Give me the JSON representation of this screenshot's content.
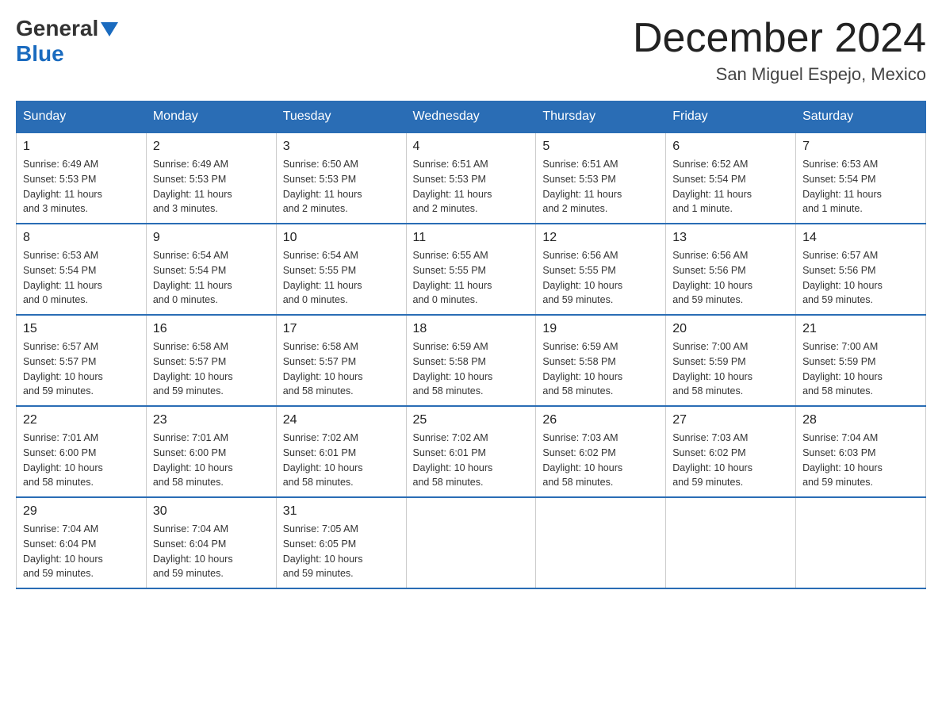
{
  "header": {
    "logo_general": "General",
    "logo_blue": "Blue",
    "title": "December 2024",
    "subtitle": "San Miguel Espejo, Mexico"
  },
  "days_of_week": [
    "Sunday",
    "Monday",
    "Tuesday",
    "Wednesday",
    "Thursday",
    "Friday",
    "Saturday"
  ],
  "weeks": [
    [
      {
        "day": "1",
        "sunrise": "6:49 AM",
        "sunset": "5:53 PM",
        "daylight": "11 hours and 3 minutes."
      },
      {
        "day": "2",
        "sunrise": "6:49 AM",
        "sunset": "5:53 PM",
        "daylight": "11 hours and 3 minutes."
      },
      {
        "day": "3",
        "sunrise": "6:50 AM",
        "sunset": "5:53 PM",
        "daylight": "11 hours and 2 minutes."
      },
      {
        "day": "4",
        "sunrise": "6:51 AM",
        "sunset": "5:53 PM",
        "daylight": "11 hours and 2 minutes."
      },
      {
        "day": "5",
        "sunrise": "6:51 AM",
        "sunset": "5:53 PM",
        "daylight": "11 hours and 2 minutes."
      },
      {
        "day": "6",
        "sunrise": "6:52 AM",
        "sunset": "5:54 PM",
        "daylight": "11 hours and 1 minute."
      },
      {
        "day": "7",
        "sunrise": "6:53 AM",
        "sunset": "5:54 PM",
        "daylight": "11 hours and 1 minute."
      }
    ],
    [
      {
        "day": "8",
        "sunrise": "6:53 AM",
        "sunset": "5:54 PM",
        "daylight": "11 hours and 0 minutes."
      },
      {
        "day": "9",
        "sunrise": "6:54 AM",
        "sunset": "5:54 PM",
        "daylight": "11 hours and 0 minutes."
      },
      {
        "day": "10",
        "sunrise": "6:54 AM",
        "sunset": "5:55 PM",
        "daylight": "11 hours and 0 minutes."
      },
      {
        "day": "11",
        "sunrise": "6:55 AM",
        "sunset": "5:55 PM",
        "daylight": "11 hours and 0 minutes."
      },
      {
        "day": "12",
        "sunrise": "6:56 AM",
        "sunset": "5:55 PM",
        "daylight": "10 hours and 59 minutes."
      },
      {
        "day": "13",
        "sunrise": "6:56 AM",
        "sunset": "5:56 PM",
        "daylight": "10 hours and 59 minutes."
      },
      {
        "day": "14",
        "sunrise": "6:57 AM",
        "sunset": "5:56 PM",
        "daylight": "10 hours and 59 minutes."
      }
    ],
    [
      {
        "day": "15",
        "sunrise": "6:57 AM",
        "sunset": "5:57 PM",
        "daylight": "10 hours and 59 minutes."
      },
      {
        "day": "16",
        "sunrise": "6:58 AM",
        "sunset": "5:57 PM",
        "daylight": "10 hours and 59 minutes."
      },
      {
        "day": "17",
        "sunrise": "6:58 AM",
        "sunset": "5:57 PM",
        "daylight": "10 hours and 58 minutes."
      },
      {
        "day": "18",
        "sunrise": "6:59 AM",
        "sunset": "5:58 PM",
        "daylight": "10 hours and 58 minutes."
      },
      {
        "day": "19",
        "sunrise": "6:59 AM",
        "sunset": "5:58 PM",
        "daylight": "10 hours and 58 minutes."
      },
      {
        "day": "20",
        "sunrise": "7:00 AM",
        "sunset": "5:59 PM",
        "daylight": "10 hours and 58 minutes."
      },
      {
        "day": "21",
        "sunrise": "7:00 AM",
        "sunset": "5:59 PM",
        "daylight": "10 hours and 58 minutes."
      }
    ],
    [
      {
        "day": "22",
        "sunrise": "7:01 AM",
        "sunset": "6:00 PM",
        "daylight": "10 hours and 58 minutes."
      },
      {
        "day": "23",
        "sunrise": "7:01 AM",
        "sunset": "6:00 PM",
        "daylight": "10 hours and 58 minutes."
      },
      {
        "day": "24",
        "sunrise": "7:02 AM",
        "sunset": "6:01 PM",
        "daylight": "10 hours and 58 minutes."
      },
      {
        "day": "25",
        "sunrise": "7:02 AM",
        "sunset": "6:01 PM",
        "daylight": "10 hours and 58 minutes."
      },
      {
        "day": "26",
        "sunrise": "7:03 AM",
        "sunset": "6:02 PM",
        "daylight": "10 hours and 58 minutes."
      },
      {
        "day": "27",
        "sunrise": "7:03 AM",
        "sunset": "6:02 PM",
        "daylight": "10 hours and 59 minutes."
      },
      {
        "day": "28",
        "sunrise": "7:04 AM",
        "sunset": "6:03 PM",
        "daylight": "10 hours and 59 minutes."
      }
    ],
    [
      {
        "day": "29",
        "sunrise": "7:04 AM",
        "sunset": "6:04 PM",
        "daylight": "10 hours and 59 minutes."
      },
      {
        "day": "30",
        "sunrise": "7:04 AM",
        "sunset": "6:04 PM",
        "daylight": "10 hours and 59 minutes."
      },
      {
        "day": "31",
        "sunrise": "7:05 AM",
        "sunset": "6:05 PM",
        "daylight": "10 hours and 59 minutes."
      },
      null,
      null,
      null,
      null
    ]
  ],
  "labels": {
    "sunrise": "Sunrise:",
    "sunset": "Sunset:",
    "daylight": "Daylight:"
  }
}
